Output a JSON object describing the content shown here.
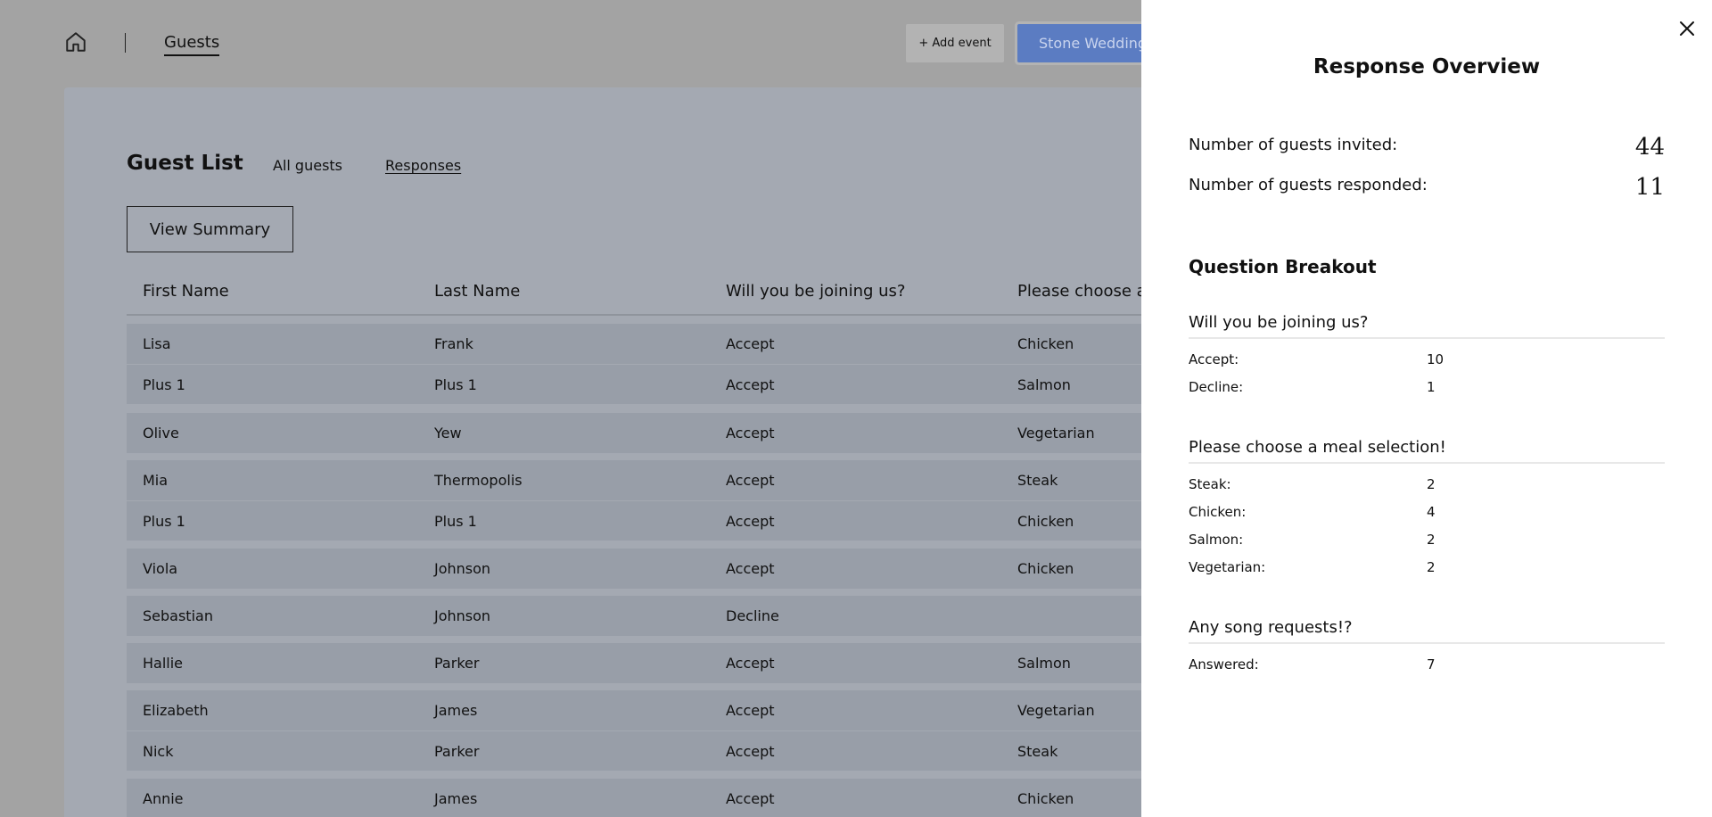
{
  "topbar": {
    "nav_label": "Guests",
    "add_event_label": "+ Add event",
    "event_name": "Stone Wedding"
  },
  "guest_list": {
    "title": "Guest List",
    "tabs": [
      {
        "label": "All guests"
      },
      {
        "label": "Responses"
      }
    ],
    "view_summary_label": "View Summary",
    "columns": [
      "First Name",
      "Last Name",
      "Will you be joining us?",
      "Please choose a"
    ],
    "rows": [
      [
        "Lisa",
        "Frank",
        "Accept",
        "Chicken"
      ],
      [
        "Plus 1",
        "Plus 1",
        "Accept",
        "Salmon"
      ],
      [
        "Olive",
        "Yew",
        "Accept",
        "Vegetarian"
      ],
      [
        "Mia",
        "Thermopolis",
        "Accept",
        "Steak"
      ],
      [
        "Plus 1",
        "Plus 1",
        "Accept",
        "Chicken"
      ],
      [
        "Viola",
        "Johnson",
        "Accept",
        "Chicken"
      ],
      [
        "Sebastian",
        "Johnson",
        "Decline",
        ""
      ],
      [
        "Hallie",
        "Parker",
        "Accept",
        "Salmon"
      ],
      [
        "Elizabeth",
        "James",
        "Accept",
        "Vegetarian"
      ],
      [
        "Nick",
        "Parker",
        "Accept",
        "Steak"
      ],
      [
        "Annie",
        "James",
        "Accept",
        "Chicken"
      ]
    ]
  },
  "overview": {
    "title": "Response Overview",
    "invited_label": "Number of guests invited:",
    "invited_value": "44",
    "responded_label": "Number of guests responded:",
    "responded_value": "11",
    "breakout_title": "Question Breakout",
    "questions": [
      {
        "title": "Will you be joining us?",
        "answers": [
          {
            "label": "Accept:",
            "value": "10"
          },
          {
            "label": "Decline:",
            "value": "1"
          }
        ]
      },
      {
        "title": "Please choose a meal selection!",
        "answers": [
          {
            "label": "Steak:",
            "value": "2"
          },
          {
            "label": "Chicken:",
            "value": "4"
          },
          {
            "label": "Salmon:",
            "value": "2"
          },
          {
            "label": "Vegetarian:",
            "value": "2"
          }
        ]
      },
      {
        "title": "Any song requests!?",
        "answers": [
          {
            "label": "Answered:",
            "value": "7"
          }
        ]
      }
    ]
  },
  "colors": {
    "overlay": "#a3a3a3",
    "event_pill": "#5b7cc2",
    "panel": "#ffffff"
  }
}
